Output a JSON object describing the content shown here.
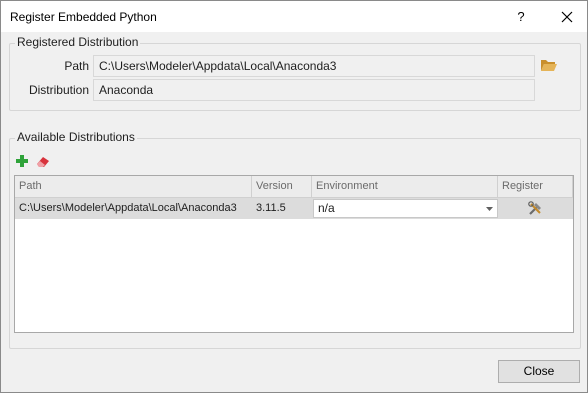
{
  "window": {
    "title": "Register Embedded Python",
    "help": "?"
  },
  "registered": {
    "group_title": "Registered Distribution",
    "path_label": "Path",
    "path_value": "C:\\Users\\Modeler\\Appdata\\Local\\Anaconda3",
    "distribution_label": "Distribution",
    "distribution_value": "Anaconda"
  },
  "available": {
    "group_title": "Available Distributions",
    "columns": [
      "Path",
      "Version",
      "Environment",
      "Register"
    ],
    "rows": [
      {
        "path": "C:\\Users\\Modeler\\Appdata\\Local\\Anaconda3",
        "version": "3.11.5",
        "environment": "n/a"
      }
    ]
  },
  "footer": {
    "close_label": "Close"
  },
  "icons": {
    "close": "close-icon",
    "folder": "folder-icon",
    "add": "plus-icon",
    "remove": "eraser-icon",
    "register": "tools-icon",
    "dropdown": "chevron-down-icon"
  },
  "colors": {
    "add_green": "#2fa33a",
    "eraser_red": "#d8323c",
    "folder_tan": "#d9a441",
    "selected_row": "#dcdcdc"
  }
}
